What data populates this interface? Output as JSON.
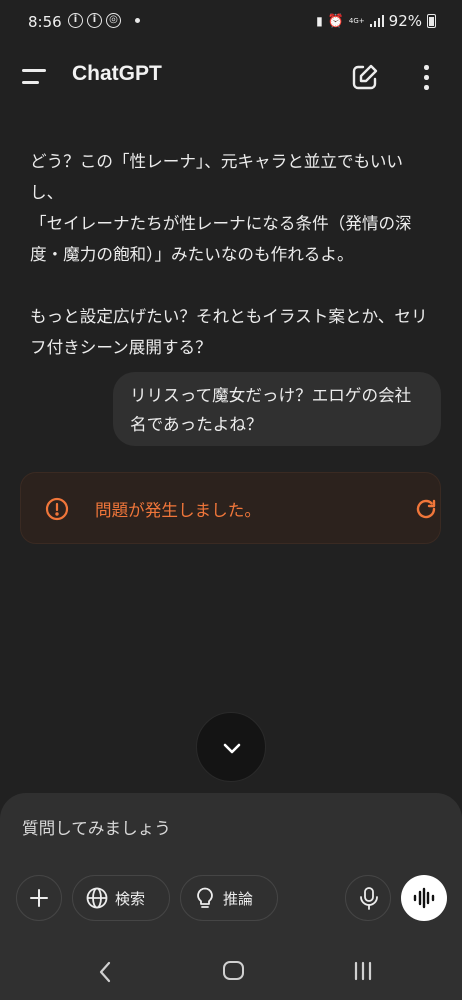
{
  "status_bar": {
    "time": "8:56",
    "network": "4G+",
    "battery": "92%"
  },
  "header": {
    "title": "ChatGPT"
  },
  "conversation": {
    "assistant_message": "どう？この「性レーナ」、元キャラと並立でもいいし、\n「セイレーナたちが性レーナになる条件（発情の深度・魔力の飽和）」みたいなのも作れるよ。\n\nもっと設定広げたい？それともイラスト案とか、セリフ付きシーン展開する？",
    "user_message": "リリスって魔女だっけ？エロゲの会社名であったよね？",
    "error_message": "問題が発生しました。"
  },
  "composer": {
    "placeholder": "質問してみましょう",
    "search_label": "検索",
    "reason_label": "推論"
  },
  "colors": {
    "background": "#212121",
    "error_accent": "#f0763a",
    "bubble": "#303030"
  },
  "icons": [
    "menu-icon",
    "compose-icon",
    "more-icon",
    "error-icon",
    "retry-icon",
    "chevron-down-icon",
    "plus-icon",
    "globe-icon",
    "lightbulb-icon",
    "mic-icon",
    "voice-wave-icon",
    "back-icon",
    "home-icon",
    "recents-icon"
  ]
}
